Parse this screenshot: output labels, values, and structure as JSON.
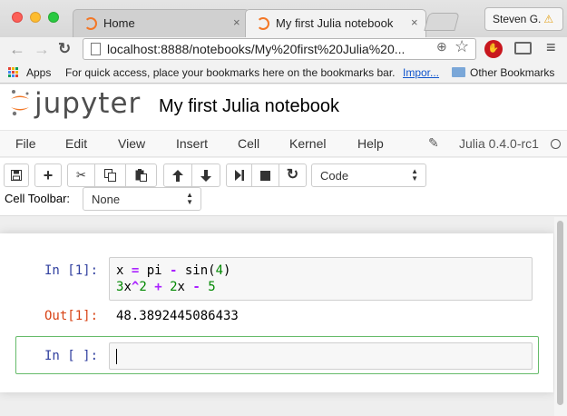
{
  "browser": {
    "tabs": [
      {
        "label": "Home",
        "active": false
      },
      {
        "label": "My first Julia notebook",
        "active": true
      }
    ],
    "user_button": "Steven G.",
    "url": "localhost:8888/notebooks/My%20first%20Julia%20...",
    "bookmarks": {
      "apps_label": "Apps",
      "hint": "For quick access, place your bookmarks here on the bookmarks bar.",
      "import_link": "Impor...",
      "other_bookmarks": "Other Bookmarks"
    },
    "icons": {
      "back": "←",
      "forward": "→",
      "reload": "C",
      "zoom": "⊕",
      "star": "☆",
      "menu": "≡",
      "close": "×",
      "warning": "⚠"
    }
  },
  "jupyter": {
    "logo_text": "jupyter",
    "notebook_title": "My first Julia notebook",
    "menu": [
      "File",
      "Edit",
      "View",
      "Insert",
      "Cell",
      "Kernel",
      "Help"
    ],
    "kernel_name": "Julia 0.4.0-rc1",
    "cell_type_select": "Code",
    "cell_toolbar_label": "Cell Toolbar:",
    "cell_toolbar_select": "None",
    "toolbar_icons": {
      "save": "💾",
      "add": "+",
      "cut": "✂",
      "copy": "⎘",
      "paste": "📋",
      "up": "🡑",
      "down": "🡓",
      "run": "▶|",
      "stop": "■",
      "restart": "↻"
    }
  },
  "cells": {
    "cell1": {
      "prompt_in": "In [1]:",
      "prompt_out": "Out[1]:",
      "output": "48.3892445086433"
    },
    "cell2": {
      "prompt_in": "In [ ]:"
    }
  },
  "colors": {
    "jupyter_orange": "#f37726",
    "prompt_in": "#303f9f",
    "prompt_out": "#d84315",
    "selected_border": "#66bb6a",
    "keyword": "#aa22ff",
    "number": "#008800"
  }
}
